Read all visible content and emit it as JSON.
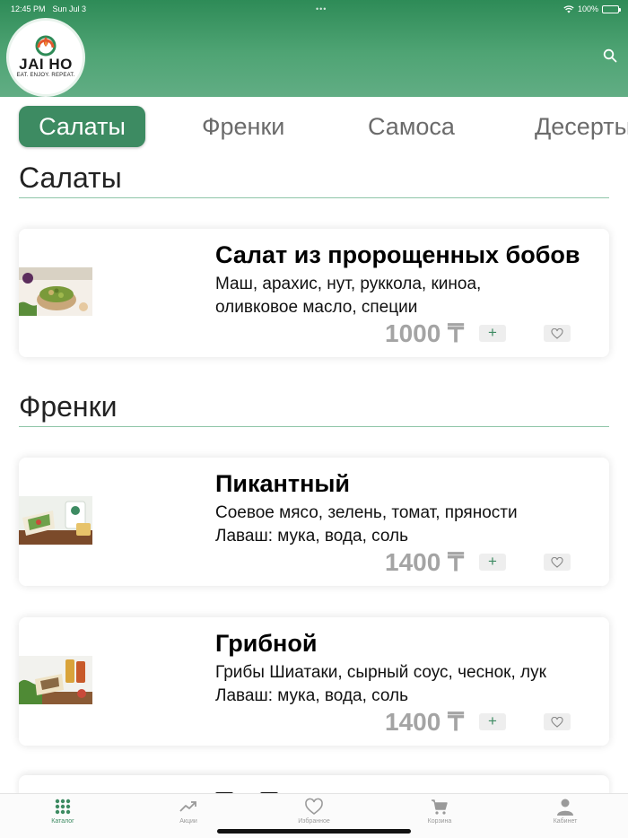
{
  "status_bar": {
    "time": "12:45 PM",
    "date": "Sun Jul 3",
    "battery": "100%"
  },
  "header": {
    "logo": {
      "brand": "JAI HO",
      "tagline": "EAT. ENJOY. REPEAT."
    },
    "search_icon": "search-icon",
    "gradient_colors": [
      "#2e8b57",
      "#61ad84"
    ]
  },
  "tabs": [
    {
      "label": "Салаты",
      "active": true
    },
    {
      "label": "Френки",
      "active": false
    },
    {
      "label": "Самоса",
      "active": false
    },
    {
      "label": "Десерты",
      "active": false
    }
  ],
  "sections": [
    {
      "title": "Салаты",
      "items": [
        {
          "name": "Салат из пророщенных бобов",
          "desc_line1": "Маш, арахис, нут, руккола, киноа,",
          "desc_line2": "оливковое масло, специи",
          "price": "1000 ₸",
          "add_label": "+"
        }
      ]
    },
    {
      "title": "Френки",
      "items": [
        {
          "name": "Пикантный",
          "desc_line1": "Соевое мясо, зелень, томат, пряности",
          "desc_line2": "Лаваш: мука, вода, соль",
          "price": "1400 ₸",
          "add_label": "+"
        },
        {
          "name": "Грибной",
          "desc_line1": "Грибы Шиатаки, сырный соус, чеснок, лук",
          "desc_line2": "Лаваш: мука, вода, соль",
          "price": "1400 ₸",
          "add_label": "+"
        }
      ]
    }
  ],
  "tabbar": [
    {
      "label": "Каталог",
      "icon": "grid-icon",
      "active": true
    },
    {
      "label": "Акции",
      "icon": "trend-icon",
      "active": false
    },
    {
      "label": "Избранное",
      "icon": "heart-icon",
      "active": false
    },
    {
      "label": "Корзина",
      "icon": "cart-icon",
      "active": false
    },
    {
      "label": "Кабинет",
      "icon": "person-icon",
      "active": false
    }
  ],
  "colors": {
    "accent": "#3d8b62",
    "price": "#a4a4a4",
    "inactive": "#9a9a9a"
  }
}
